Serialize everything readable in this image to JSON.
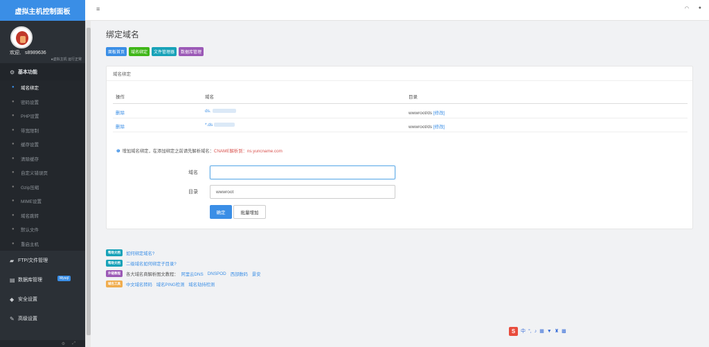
{
  "app": {
    "title": "虚拟主机控制面板"
  },
  "user": {
    "welcome": "欢迎,",
    "username": "s8989636",
    "status": "●虚拟主机  运行正常"
  },
  "sidebar": {
    "group_basic": "基本功能",
    "items": [
      "域名绑定",
      "密码设置",
      "PHP设置",
      "带宽限制",
      "缓存设置",
      "清除缓存",
      "自定义错误页",
      "Gzip压缩",
      "MIME设置",
      "域名跳转",
      "默认文件",
      "重启主机"
    ],
    "group_ftp": "FTP/文件管理",
    "group_db": "数据库管理",
    "db_badge": "Mysql",
    "group_security": "安全设置",
    "group_advanced": "高级设置"
  },
  "page": {
    "title": "绑定域名"
  },
  "nav_buttons": [
    {
      "label": "面板首页",
      "color": "#3a8ee6"
    },
    {
      "label": "域名绑定",
      "color": "#3fb618"
    },
    {
      "label": "文件管理器",
      "color": "#17a2b8"
    },
    {
      "label": "数据库管理",
      "color": "#9b59b6"
    }
  ],
  "card": {
    "header": "域名绑定",
    "columns": [
      "操作",
      "域名",
      "目录"
    ],
    "rows": [
      {
        "action": "删除",
        "domain": "ds.",
        "dir": "wwwroot/ds",
        "edit": "[修改]"
      },
      {
        "action": "删除",
        "domain": "*.ds",
        "dir": "wwwroot/ds",
        "edit": "[修改]"
      }
    ],
    "notice_pre": "增加域名绑定，在添加绑定之前请先解析域名：",
    "notice_cname": "CNAME解析到：",
    "notice_target": "ns.yuncname.com",
    "form": {
      "domain_label": "域名",
      "domain_value": "",
      "dir_label": "目录",
      "dir_value": "wwwroot",
      "confirm": "确定",
      "batch": "批量增加"
    }
  },
  "help": [
    {
      "tag": "帮助文档",
      "tag_color": "#17a2b8",
      "links": [
        "如何绑定域名?"
      ]
    },
    {
      "tag": "帮助文档",
      "tag_color": "#17a2b8",
      "links": [
        "二级域名如何绑定子目录?"
      ]
    },
    {
      "tag": "外链教程",
      "tag_color": "#9b59b6",
      "text": "各大域名商解析图文教程：",
      "links": [
        "阿里云DNS",
        "DNSPOD",
        "西部数码",
        "景安"
      ]
    },
    {
      "tag": "域名工具",
      "tag_color": "#f0ad4e",
      "links": [
        "中文域名转码",
        "域名PING检测",
        "域名劫持检测"
      ]
    }
  ],
  "ime": {
    "label": "中"
  }
}
